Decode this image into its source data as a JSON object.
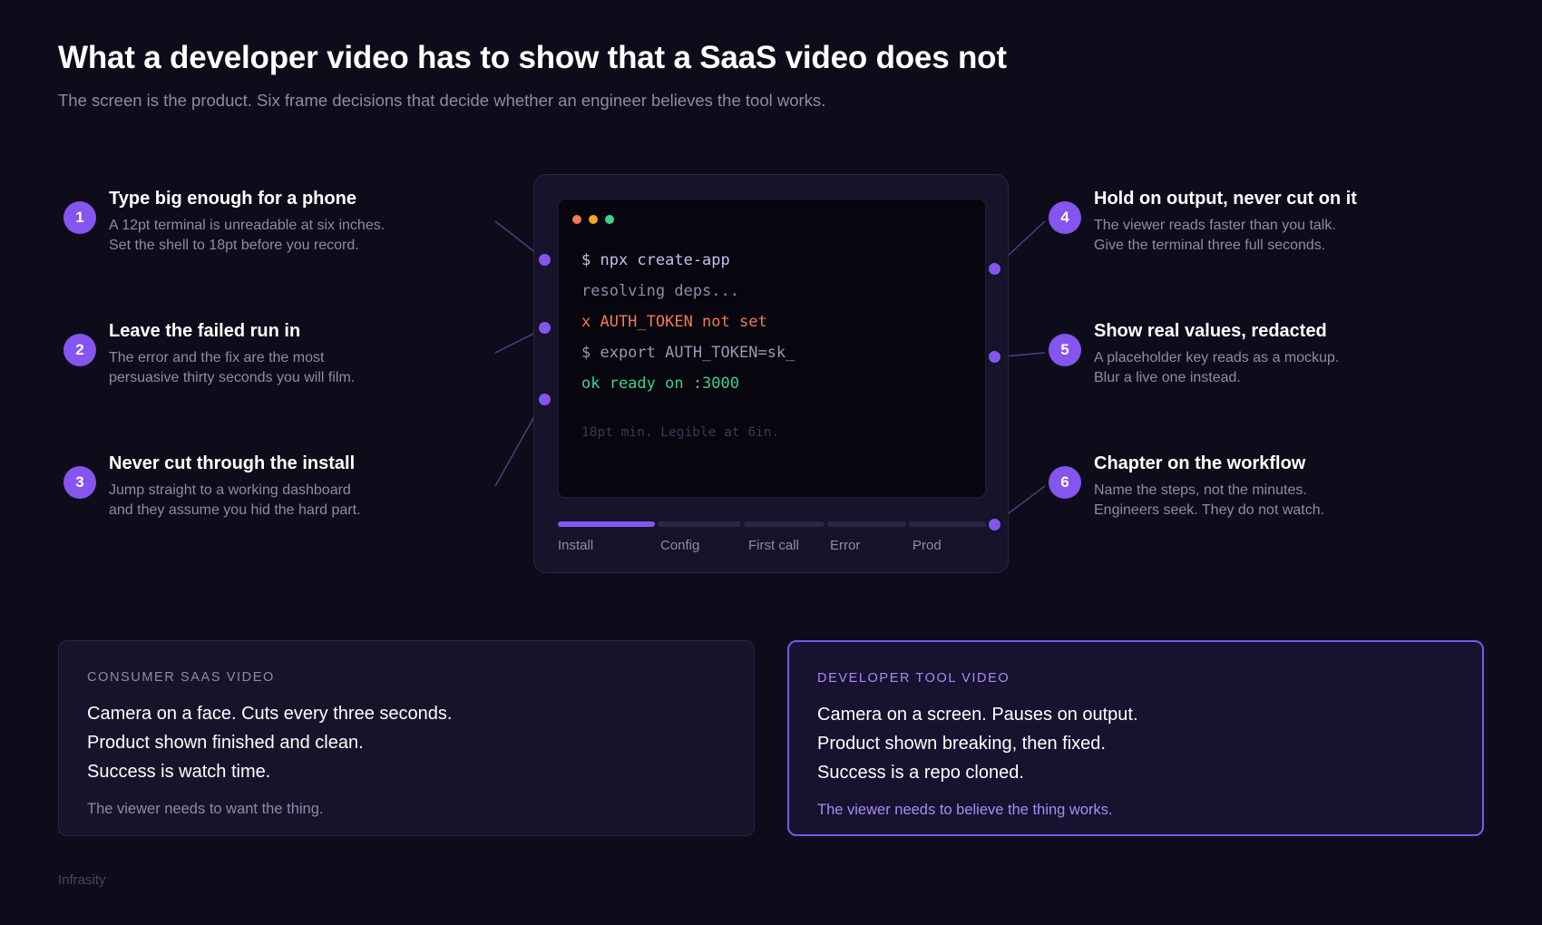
{
  "title": "What a developer video has to show that a SaaS video does not",
  "subtitle": "The screen is the product. Six frame decisions that decide whether an engineer believes the tool works.",
  "callouts": [
    {
      "num": "1",
      "title": "Type big enough for a phone",
      "lines": [
        "A 12pt terminal is unreadable at six inches.",
        "Set the shell to 18pt before you record."
      ]
    },
    {
      "num": "2",
      "title": "Leave the failed run in",
      "lines": [
        "The error and the fix are the most",
        "persuasive thirty seconds you will film."
      ]
    },
    {
      "num": "3",
      "title": "Never cut through the install",
      "lines": [
        "Jump straight to a working dashboard",
        "and they assume you hid the hard part."
      ]
    },
    {
      "num": "4",
      "title": "Hold on output, never cut on it",
      "lines": [
        "The viewer reads faster than you talk.",
        "Give the terminal three full seconds."
      ]
    },
    {
      "num": "5",
      "title": "Show real values, redacted",
      "lines": [
        "A placeholder key reads as a mockup.",
        "Blur a live one instead."
      ]
    },
    {
      "num": "6",
      "title": "Chapter on the workflow",
      "lines": [
        "Name the steps, not the minutes.",
        "Engineers seek. They do not watch."
      ]
    }
  ],
  "terminal": {
    "lines": [
      {
        "text": "$ npx create-app",
        "color": "#c7c0ee"
      },
      {
        "text": "resolving deps...",
        "color": "#8f8aa8"
      },
      {
        "text": "x AUTH_TOKEN not set",
        "color": "#f07a56"
      },
      {
        "text": "$ export AUTH_TOKEN=sk_",
        "color": "#9d98b4"
      },
      {
        "text": "ok ready on :3000",
        "color": "#3fcf8e"
      }
    ],
    "note": "18pt min. Legible at 6in.",
    "window_dots": [
      "#f07a56",
      "#f5a524",
      "#3fcf8e"
    ]
  },
  "timeline": {
    "chapters": [
      "Install",
      "Config",
      "First call",
      "Error",
      "Prod"
    ],
    "active_chapter": "Install"
  },
  "cards": {
    "consumer": {
      "tag": "CONSUMER SAAS VIDEO",
      "lines": [
        "Camera on a face. Cuts every three seconds.",
        "Product shown finished and clean.",
        "Success is watch time."
      ],
      "footer": "The viewer needs to want the thing."
    },
    "developer": {
      "tag": "DEVELOPER TOOL VIDEO",
      "lines": [
        "Camera on a screen. Pauses on output.",
        "Product shown breaking, then fixed.",
        "Success is a repo cloned."
      ],
      "footer": "The viewer needs to believe the thing works."
    }
  },
  "brand": "Infrasity",
  "colors": {
    "background": "#0e0c1a",
    "accent": "#8455ef",
    "text_muted": "#8f8aa8",
    "error": "#f07a56",
    "success": "#3fcf8e"
  }
}
